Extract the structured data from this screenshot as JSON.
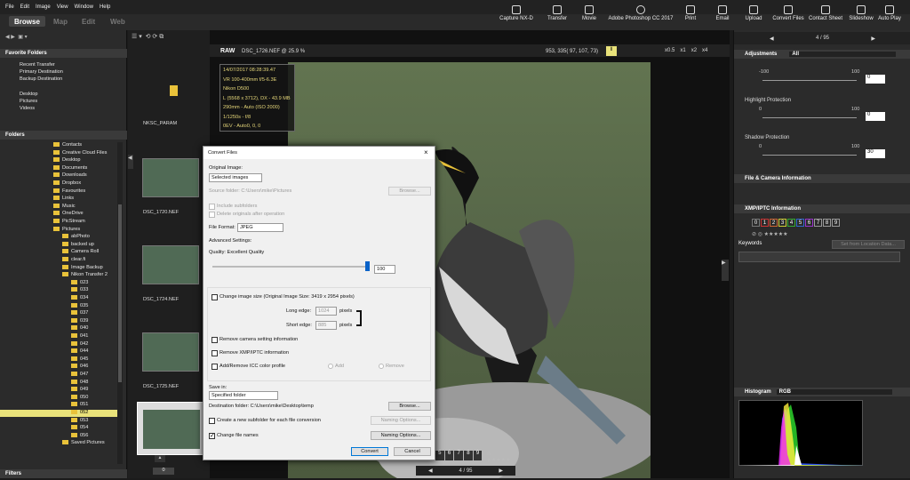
{
  "menu": [
    "File",
    "Edit",
    "Image",
    "View",
    "Window",
    "Help"
  ],
  "modes": {
    "browse": "Browse",
    "map": "Map",
    "edit": "Edit",
    "web": "Web"
  },
  "tools": {
    "capture": "Capture NX-D",
    "transfer": "Transfer",
    "movie": "Movie",
    "photoshop": "Adobe Photoshop CC 2017",
    "print": "Print",
    "email": "Email",
    "upload": "Upload",
    "convert": "Convert Files",
    "contact": "Contact Sheet",
    "slideshow": "Slideshow",
    "autoplay": "Auto Play"
  },
  "left": {
    "sort": "Sort  ABC",
    "filter": "Filter",
    "favorites_title": "Favorite Folders",
    "favorites": [
      "Recent Transfer",
      "Primary Destination",
      "Backup Destination"
    ],
    "places": [
      "Desktop",
      "Pictures",
      "Videos"
    ],
    "folders_title": "Folders",
    "tree": [
      "Contacts",
      "Creative Cloud Files",
      "Desktop",
      "Documents",
      "Downloads",
      "Dropbox",
      "Favourites",
      "Links",
      "Music",
      "OneDrive",
      "PicStream",
      "Pictures",
      "abPhoto",
      "backed up",
      "Camera Roll",
      "clear.fi",
      "Image Backup",
      "Nikon Transfer 2",
      "023",
      "033",
      "034",
      "035",
      "037",
      "039",
      "040",
      "041",
      "042",
      "044",
      "045",
      "046",
      "047",
      "048",
      "049",
      "050",
      "051",
      "052",
      "053",
      "054",
      "056",
      "Saved Pictures"
    ],
    "filters": "Filters",
    "count": "0"
  },
  "thumbs": {
    "items": [
      "NKSC_PARAM",
      "DSC_1720.NEF",
      "DSC_1724.NEF",
      "DSC_1725.NEF"
    ],
    "count": "0"
  },
  "viewer": {
    "raw": "RAW",
    "filename": "DSC_1726.NEF @ 25.9 %",
    "coords": "953, 335( 97, 107, 73)",
    "info": [
      "14/07/2017 08:28:39.47",
      "VR 100-400mm f/5-6.3E",
      "Nikon D500",
      "L (5568 x 3712), DX - 43.9 MB",
      "290mm - Auto (ISO 2000)",
      "1/1250s - f/8",
      "0EV - Auto0, 0, 0"
    ],
    "zoom": [
      "x0.5",
      "x1",
      "x2",
      "x4"
    ],
    "nav": "4 / 95",
    "labels": [
      "5",
      "6",
      "7",
      "8",
      "9"
    ]
  },
  "dialog": {
    "title": "Convert Files",
    "original_image": "Original Image:",
    "original_select": "Selected images",
    "source_folder": "Source folder: C:\\Users\\mike\\Pictures",
    "browse": "Browse...",
    "include_sub": "Include subfolders",
    "delete_orig": "Delete originals after operation",
    "file_format": "File Format:",
    "format_value": "JPEG",
    "advanced": "Advanced Settings:",
    "quality": "Quality: Excellent Quality",
    "quality_value": "100",
    "change_size": "Change image size (Original Image Size: 3419 x 2954 pixels)",
    "long_edge": "Long edge:",
    "long_value": "1024",
    "short_edge": "Short edge:",
    "short_value": "885",
    "pixels": "pixels",
    "remove_camera": "Remove camera setting information",
    "remove_xmp": "Remove XMP/IPTC information",
    "icc": "Add/Remove ICC color profile",
    "add": "Add",
    "remove": "Remove",
    "save_in": "Save in:",
    "save_select": "Specified folder",
    "dest_folder": "Destination folder: C:\\Users\\mike\\Desktop\\temp",
    "browse2": "Browse...",
    "create_sub": "Create a new subfolder for each file conversion",
    "naming1": "Naming Options...",
    "change_names": "Change file names",
    "naming2": "Naming Options...",
    "convert": "Convert",
    "cancel": "Cancel"
  },
  "right": {
    "nav": "4 / 95",
    "adjustments": "Adjustments",
    "adj_mode": "All",
    "sliders": [
      {
        "label": "",
        "min": "-100",
        "max": "100",
        "value": "0"
      },
      {
        "label": "Highlight Protection",
        "min": "0",
        "max": "100",
        "value": "0"
      },
      {
        "label": "Shadow Protection",
        "min": "0",
        "max": "100",
        "value": "30"
      }
    ],
    "file_info": "File & Camera Information",
    "xmp": "XMP/IPTC Information",
    "labels": [
      "0",
      "1",
      "2",
      "3",
      "4",
      "5",
      "6",
      "7",
      "8",
      "9"
    ],
    "keywords": "Keywords",
    "set_location": "Set from Location Data...",
    "histogram": "Histogram",
    "hist_mode": "RGB"
  },
  "colors": {
    "accent": "#e9c23a",
    "selected_row": "#e9e27a"
  }
}
